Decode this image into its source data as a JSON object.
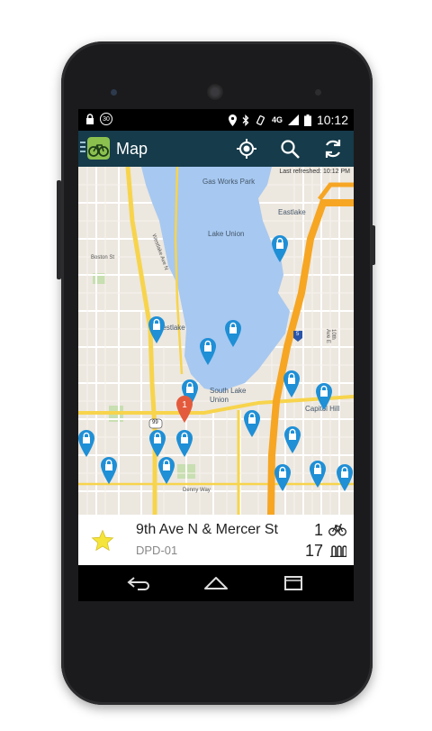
{
  "status_bar": {
    "time": "10:12",
    "network": "4G",
    "notification_badge": "30",
    "icons": [
      "lock-icon",
      "location-icon",
      "bluetooth-icon",
      "vibrate-icon",
      "signal-icon",
      "battery-icon"
    ]
  },
  "action_bar": {
    "title": "Map",
    "actions": [
      "my-location-icon",
      "search-icon",
      "refresh-icon"
    ]
  },
  "map": {
    "last_refreshed": "Last refreshed: 10:12 PM",
    "labels": {
      "gas_works": "Gas Works Park",
      "lake_union": "Lake Union",
      "eastlake": "Eastlake",
      "westlake": "Westlake",
      "south_lake_union": "South Lake Union",
      "capitol_hill": "Capitol Hill",
      "boston_st": "Boston St",
      "westlake_ave": "Westlake Ave N",
      "ave_e_10th": "10th Ave E",
      "denny_way": "Denny Way",
      "highway_99": "99",
      "interstate_5": "5"
    },
    "selected_pin_label": "1",
    "colors": {
      "water": "#a7c8f0",
      "highway": "#f6a623",
      "pin_blue": "#1f8fd6",
      "pin_selected": "#e35b3c"
    }
  },
  "station": {
    "name": "9th Ave N & Mercer St",
    "id": "DPD-01",
    "bikes": "1",
    "docks": "17",
    "favorite": true
  },
  "nav_bar": {
    "buttons": [
      "back-icon",
      "home-icon",
      "recents-icon"
    ]
  }
}
